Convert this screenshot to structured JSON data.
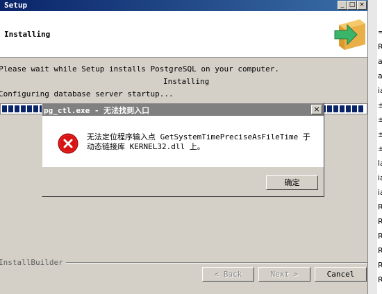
{
  "setup": {
    "title": "Setup",
    "header_title": "Installing",
    "line1": "Please wait while Setup installs PostgreSQL on your computer.",
    "line2": "Installing",
    "line3": "Configuring database server startup...",
    "progress_fraction": 1.0,
    "installbuilder": "InstallBuilder",
    "back": "< Back",
    "next": "Next >",
    "cancel": "Cancel"
  },
  "dialog": {
    "title": "pg_ctl.exe - 无法找到入口",
    "message_line1": "无法定位程序输入点 GetSystemTimePreciseAsFileTime 于",
    "message_line2": "动态链接库 KERNEL32.dll 上。",
    "ok": "确定"
  },
  "strip": {
    "fragments": [
      "=",
      "R",
      "a",
      "a",
      "ia",
      "±",
      "±",
      "±",
      "±",
      "la",
      "ia",
      "ia",
      "Ra",
      "Ra",
      "Ra",
      "Ra",
      "Ra",
      "Ra"
    ]
  }
}
